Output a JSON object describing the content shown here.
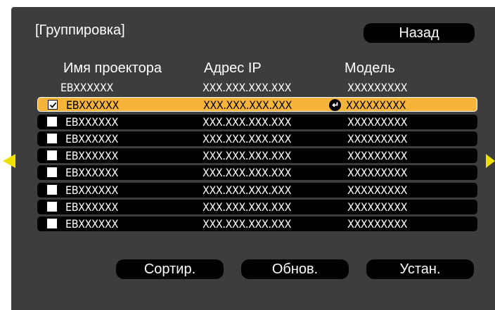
{
  "screen": {
    "title": "[Группировка]",
    "back_label": "Назад"
  },
  "columns": {
    "name": "Имя проектора",
    "ip": "Адрес IP",
    "model": "Модель"
  },
  "rows": [
    {
      "name": "EBXXXXXX",
      "ip": "XXX.XXX.XXX.XXX",
      "model": "XXXXXXXXX",
      "checkbox": false,
      "checked": false,
      "selected": false
    },
    {
      "name": "EBXXXXXX",
      "ip": "XXX.XXX.XXX.XXX",
      "model": "XXXXXXXXX",
      "checkbox": true,
      "checked": true,
      "selected": true
    },
    {
      "name": "EBXXXXXX",
      "ip": "XXX.XXX.XXX.XXX",
      "model": "XXXXXXXXX",
      "checkbox": true,
      "checked": false,
      "selected": false
    },
    {
      "name": "EBXXXXXX",
      "ip": "XXX.XXX.XXX.XXX",
      "model": "XXXXXXXXX",
      "checkbox": true,
      "checked": false,
      "selected": false
    },
    {
      "name": "EBXXXXXX",
      "ip": "XXX.XXX.XXX.XXX",
      "model": "XXXXXXXXX",
      "checkbox": true,
      "checked": false,
      "selected": false
    },
    {
      "name": "EBXXXXXX",
      "ip": "XXX.XXX.XXX.XXX",
      "model": "XXXXXXXXX",
      "checkbox": true,
      "checked": false,
      "selected": false
    },
    {
      "name": "EBXXXXXX",
      "ip": "XXX.XXX.XXX.XXX",
      "model": "XXXXXXXXX",
      "checkbox": true,
      "checked": false,
      "selected": false
    },
    {
      "name": "EBXXXXXX",
      "ip": "XXX.XXX.XXX.XXX",
      "model": "XXXXXXXXX",
      "checkbox": true,
      "checked": false,
      "selected": false
    },
    {
      "name": "EBXXXXXX",
      "ip": "XXX.XXX.XXX.XXX",
      "model": "XXXXXXXXX",
      "checkbox": true,
      "checked": false,
      "selected": false
    }
  ],
  "footer": {
    "sort_label": "Сортир.",
    "refresh_label": "Обнов.",
    "apply_label": "Устан."
  },
  "icons": {
    "prev_page": "arrow-left-icon",
    "next_page": "arrow-right-icon",
    "enter": "enter-icon",
    "checkbox": "checkbox-icon"
  },
  "colors": {
    "panel": "#3d3d3d",
    "row": "#000000",
    "selected_row": "#f7b43b",
    "nav_arrows": "#f0e000"
  }
}
